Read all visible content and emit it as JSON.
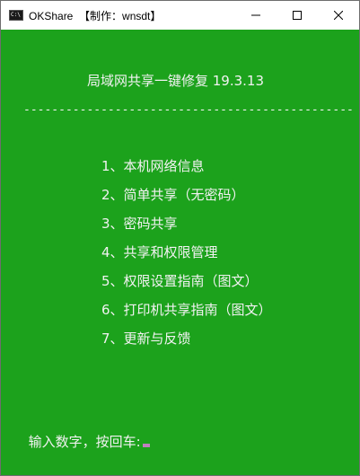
{
  "window": {
    "title": "OKShare  【制作：wnsdt】",
    "background_color": "#1ca21c",
    "text_color": "#f2f2f2"
  },
  "console": {
    "heading": "局域网共享一键修复 19.3.13",
    "divider": "-----------------------------------------------",
    "menu": [
      {
        "label": "1、本机网络信息"
      },
      {
        "label": "2、简单共享（无密码）"
      },
      {
        "label": "3、密码共享"
      },
      {
        "label": "4、共享和权限管理"
      },
      {
        "label": "5、权限设置指南（图文）"
      },
      {
        "label": "6、打印机共享指南（图文）"
      },
      {
        "label": "7、更新与反馈"
      }
    ],
    "prompt": "输入数字，按回车:"
  },
  "icons": {
    "app": "console-icon",
    "minimize": "minimize-icon",
    "maximize": "maximize-icon",
    "close": "close-icon"
  }
}
